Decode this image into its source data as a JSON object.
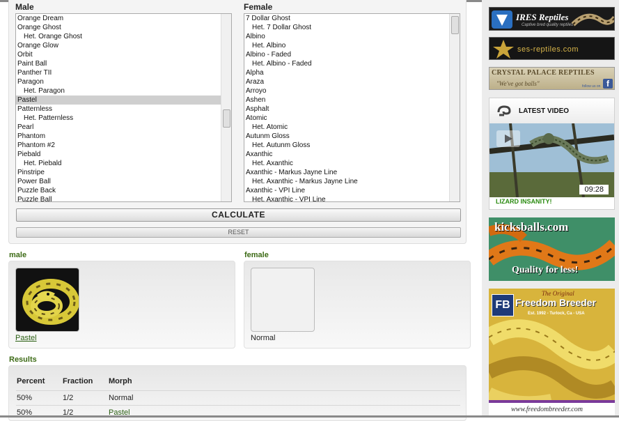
{
  "calculator": {
    "male_label": "Male",
    "female_label": "Female",
    "male_options": [
      {
        "label": "Orange Dream",
        "indent": false,
        "selected": false
      },
      {
        "label": "Orange Ghost",
        "indent": false,
        "selected": false
      },
      {
        "label": "Het. Orange Ghost",
        "indent": true,
        "selected": false
      },
      {
        "label": "Orange Glow",
        "indent": false,
        "selected": false
      },
      {
        "label": "Orbit",
        "indent": false,
        "selected": false
      },
      {
        "label": "Paint Ball",
        "indent": false,
        "selected": false
      },
      {
        "label": "Panther TII",
        "indent": false,
        "selected": false
      },
      {
        "label": "Paragon",
        "indent": false,
        "selected": false
      },
      {
        "label": "Het. Paragon",
        "indent": true,
        "selected": false
      },
      {
        "label": "Pastel",
        "indent": false,
        "selected": true
      },
      {
        "label": "Patternless",
        "indent": false,
        "selected": false
      },
      {
        "label": "Het. Patternless",
        "indent": true,
        "selected": false
      },
      {
        "label": "Pearl",
        "indent": false,
        "selected": false
      },
      {
        "label": "Phantom",
        "indent": false,
        "selected": false
      },
      {
        "label": "Phantom #2",
        "indent": false,
        "selected": false
      },
      {
        "label": "Piebald",
        "indent": false,
        "selected": false
      },
      {
        "label": "Het. Piebald",
        "indent": true,
        "selected": false
      },
      {
        "label": "Pinstripe",
        "indent": false,
        "selected": false
      },
      {
        "label": "Power Ball",
        "indent": false,
        "selected": false
      },
      {
        "label": "Puzzle Back",
        "indent": false,
        "selected": false
      },
      {
        "label": "Puzzle Ball",
        "indent": false,
        "selected": false
      }
    ],
    "female_options": [
      {
        "label": "7 Dollar Ghost",
        "indent": false,
        "selected": false
      },
      {
        "label": "Het. 7 Dollar Ghost",
        "indent": true,
        "selected": false
      },
      {
        "label": "Albino",
        "indent": false,
        "selected": false
      },
      {
        "label": "Het. Albino",
        "indent": true,
        "selected": false
      },
      {
        "label": "Albino - Faded",
        "indent": false,
        "selected": false
      },
      {
        "label": "Het. Albino - Faded",
        "indent": true,
        "selected": false
      },
      {
        "label": "Alpha",
        "indent": false,
        "selected": false
      },
      {
        "label": "Araza",
        "indent": false,
        "selected": false
      },
      {
        "label": "Arroyo",
        "indent": false,
        "selected": false
      },
      {
        "label": "Ashen",
        "indent": false,
        "selected": false
      },
      {
        "label": "Asphalt",
        "indent": false,
        "selected": false
      },
      {
        "label": "Atomic",
        "indent": false,
        "selected": false
      },
      {
        "label": "Het. Atomic",
        "indent": true,
        "selected": false
      },
      {
        "label": "Autunm Gloss",
        "indent": false,
        "selected": false
      },
      {
        "label": "Het. Autunm Gloss",
        "indent": true,
        "selected": false
      },
      {
        "label": "Axanthic",
        "indent": false,
        "selected": false
      },
      {
        "label": "Het. Axanthic",
        "indent": true,
        "selected": false
      },
      {
        "label": "Axanthic - Markus Jayne Line",
        "indent": false,
        "selected": false
      },
      {
        "label": "Het. Axanthic - Markus Jayne Line",
        "indent": true,
        "selected": false
      },
      {
        "label": "Axanthic - VPI Line",
        "indent": false,
        "selected": false
      },
      {
        "label": "Het. Axanthic - VPI Line",
        "indent": true,
        "selected": false
      }
    ],
    "calculate_label": "CALCULATE",
    "reset_label": "RESET"
  },
  "selection": {
    "male_heading": "male",
    "female_heading": "female",
    "male_morph": "Pastel",
    "female_morph": "Normal"
  },
  "results": {
    "heading": "Results",
    "columns": [
      "Percent",
      "Fraction",
      "Morph"
    ],
    "rows": [
      {
        "percent": "50%",
        "fraction": "1/2",
        "morph": "Normal",
        "link": false
      },
      {
        "percent": "50%",
        "fraction": "1/2",
        "morph": "Pastel",
        "link": true
      }
    ]
  },
  "sidebar": {
    "ires": {
      "name": "IRES Reptiles",
      "tagline": "Captive bred quality reptiles"
    },
    "ses": {
      "name": "ses-reptiles.com"
    },
    "crystal": {
      "name": "CRYSTAL PALACE REPTILES",
      "tagline": "\"We've got balls\"",
      "follow": "follow us on"
    },
    "video": {
      "heading": "LATEST VIDEO",
      "duration": "09:28",
      "caption": "LIZARD INSANITY!"
    },
    "kicks": {
      "name": "kicksballs.com",
      "tagline": "Quality for less!"
    },
    "fb": {
      "logo": "FB",
      "the_original": "The Original",
      "name": "Freedom Breeder",
      "info": "Est. 1992 - Turlock, Ca - USA",
      "url": "www.freedombreeder.com"
    }
  },
  "colors": {
    "accent_green": "#3d6b16",
    "link_green": "#2a5e12",
    "video_caption": "#2a8a10"
  }
}
